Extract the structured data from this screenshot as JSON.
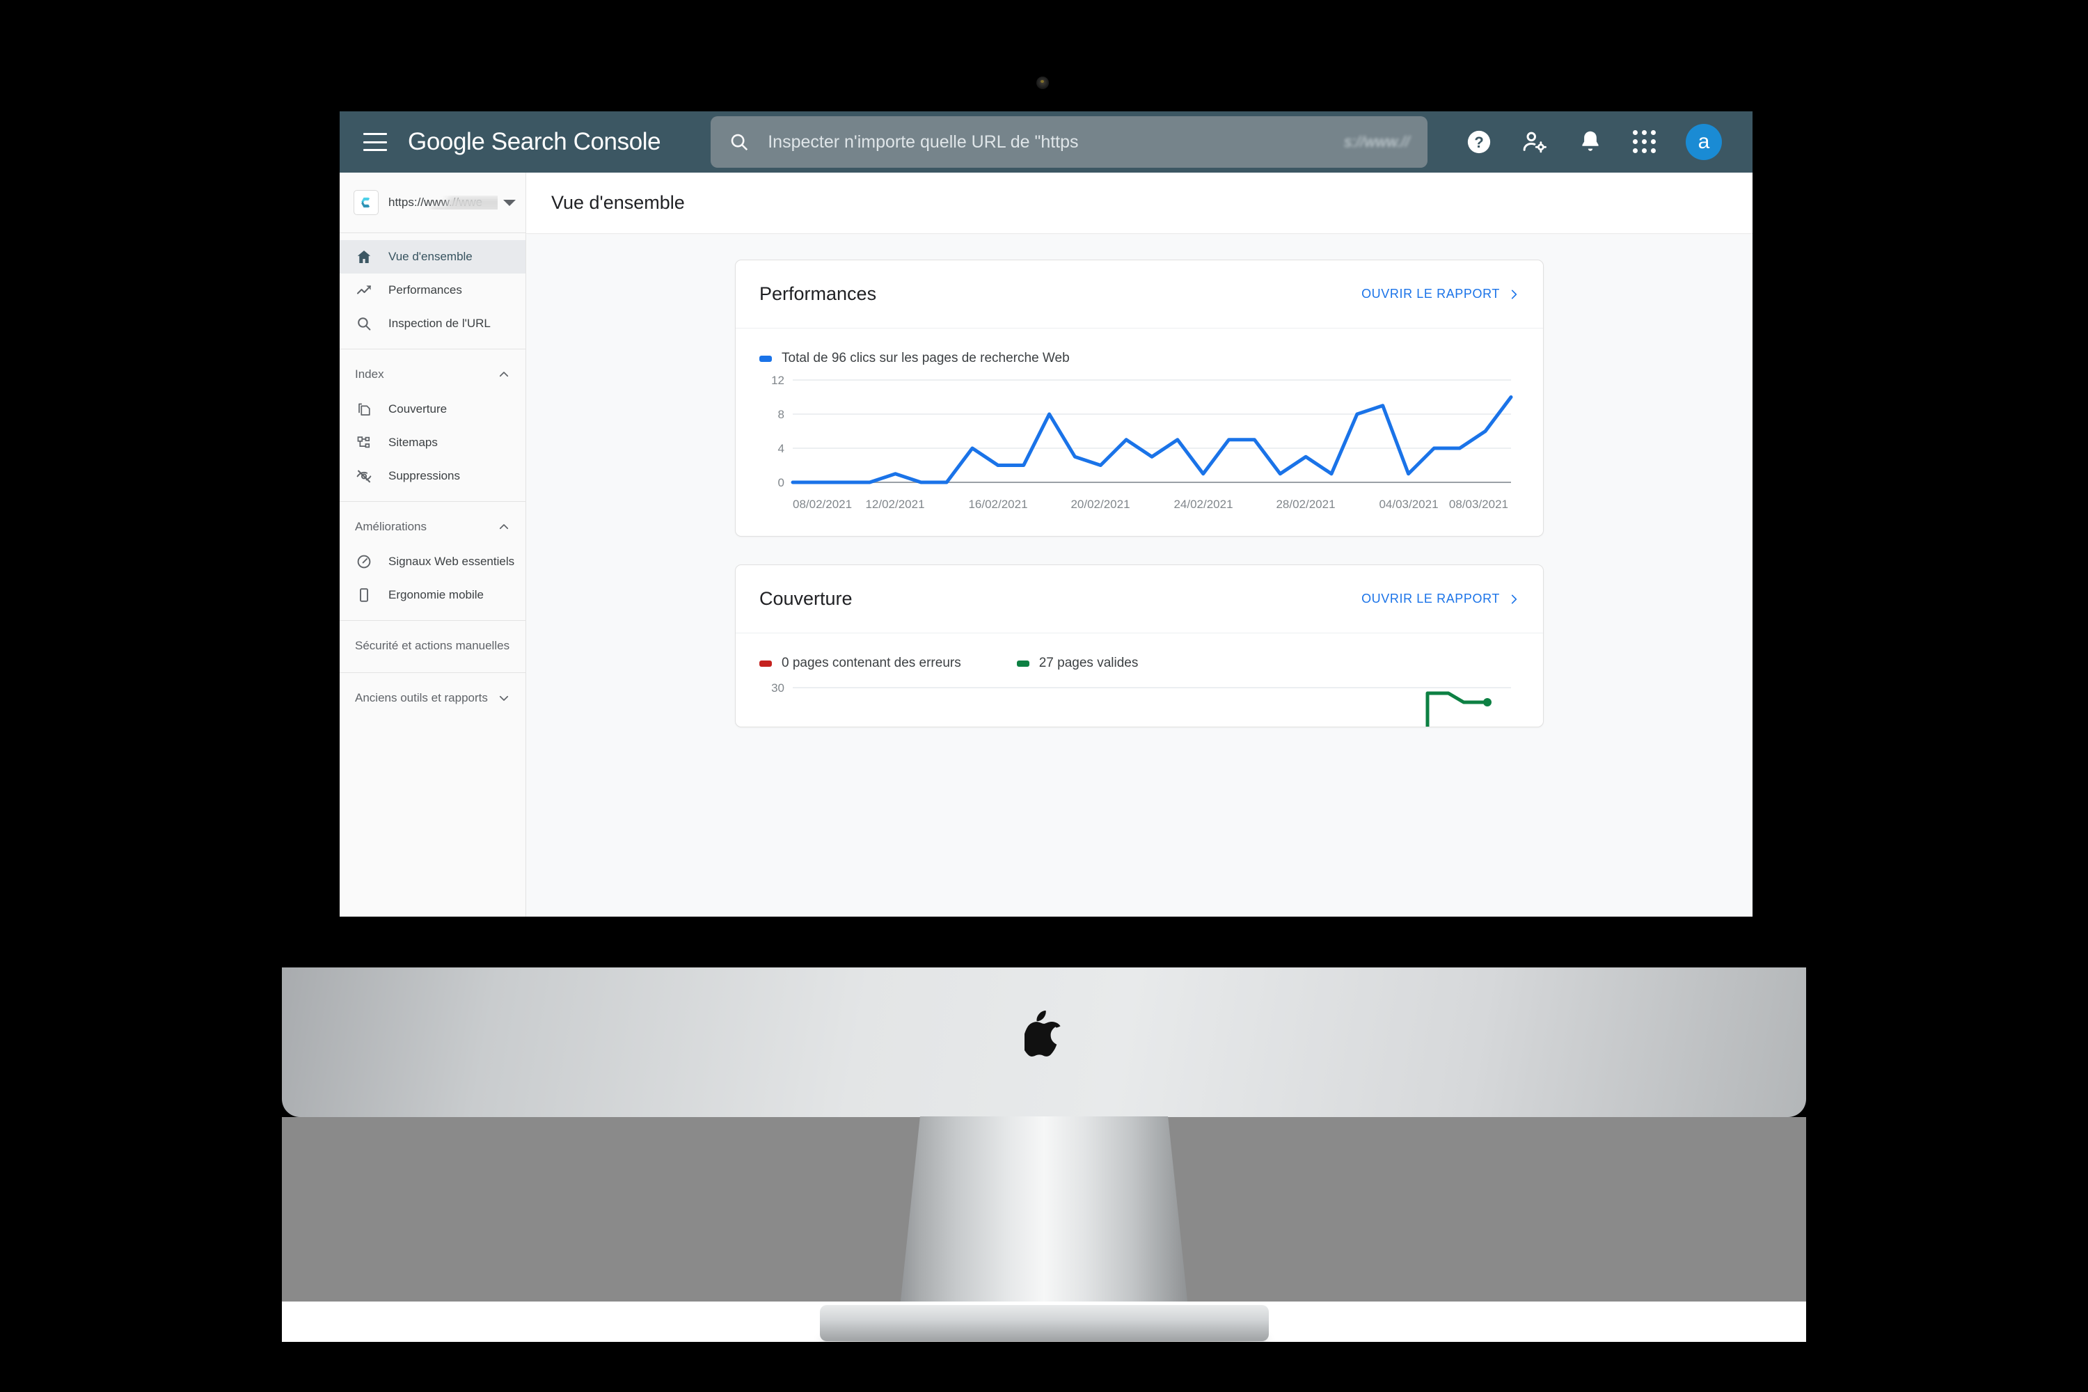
{
  "appbar": {
    "menu_label": "Menu principal",
    "brand_google": "Google",
    "brand_product": "Search Console",
    "search_placeholder": "Inspecter n'importe quelle URL de \"https",
    "search_value": "",
    "search_blur_tail": "s://www.//",
    "help_icon": "help-icon",
    "account_settings_icon": "account-settings-icon",
    "notifications_icon": "bell-icon",
    "apps_icon": "apps-grid-icon",
    "avatar_letter": "a",
    "avatar_color": "#1a8bd4",
    "bar_color": "#3c5763",
    "search_bg": "#76848b"
  },
  "sidebar": {
    "property": {
      "url": "https://www.//wwe",
      "logo_icon": "property-logo-c-icon",
      "dropdown_icon": "chevron-down-icon"
    },
    "primary": [
      {
        "label": "Vue d'ensemble",
        "icon": "home-icon",
        "active": true
      },
      {
        "label": "Performances",
        "icon": "trending-up-icon",
        "active": false
      },
      {
        "label": "Inspection de l'URL",
        "icon": "search-icon",
        "active": false
      }
    ],
    "groups": [
      {
        "header": "Index",
        "chevron": "chevron-up-icon",
        "expanded": true,
        "items": [
          {
            "label": "Couverture",
            "icon": "pages-copy-icon"
          },
          {
            "label": "Sitemaps",
            "icon": "sitemap-icon"
          },
          {
            "label": "Suppressions",
            "icon": "eye-off-icon"
          }
        ]
      },
      {
        "header": "Améliorations",
        "chevron": "chevron-up-icon",
        "expanded": true,
        "items": [
          {
            "label": "Signaux Web essentiels",
            "icon": "speedometer-icon"
          },
          {
            "label": "Ergonomie mobile",
            "icon": "mobile-phone-icon"
          }
        ]
      },
      {
        "header": "Sécurité et actions manuelles",
        "chevron": "chevron-down-icon",
        "expanded": false,
        "items": []
      },
      {
        "header": "Anciens outils et rapports",
        "chevron": "chevron-down-icon",
        "expanded": false,
        "items": []
      }
    ]
  },
  "page": {
    "title": "Vue d'ensemble"
  },
  "cards": [
    {
      "title": "Performances",
      "link_label": "OUVRIR LE RAPPORT",
      "link_icon": "chevron-right-icon",
      "legend": [
        {
          "label": "Total de 96 clics sur les pages de recherche Web",
          "color": "#1a73e8"
        }
      ]
    },
    {
      "title": "Couverture",
      "link_label": "OUVRIR LE RAPPORT",
      "link_icon": "chevron-right-icon",
      "legend": [
        {
          "label": "0 pages contenant des erreurs",
          "color": "#c5221f"
        },
        {
          "label": "27 pages valides",
          "color": "#0d8043"
        }
      ]
    }
  ],
  "chart_data": [
    {
      "type": "line",
      "title": "Performances",
      "series_name": "Total de 96 clics sur les pages de recherche Web",
      "color": "#1a73e8",
      "xlabel": "",
      "ylabel": "",
      "ylim": [
        0,
        12
      ],
      "yticks": [
        0,
        4,
        8,
        12
      ],
      "grid": true,
      "legend_position": "top-left",
      "x": [
        "08/02/2021",
        "09/02/2021",
        "10/02/2021",
        "11/02/2021",
        "12/02/2021",
        "13/02/2021",
        "14/02/2021",
        "15/02/2021",
        "16/02/2021",
        "17/02/2021",
        "18/02/2021",
        "19/02/2021",
        "20/02/2021",
        "21/02/2021",
        "22/02/2021",
        "23/02/2021",
        "24/02/2021",
        "25/02/2021",
        "26/02/2021",
        "27/02/2021",
        "28/02/2021",
        "01/03/2021",
        "02/03/2021",
        "03/03/2021",
        "04/03/2021",
        "05/03/2021",
        "06/03/2021",
        "07/03/2021",
        "08/03/2021",
        "09/03/2021"
      ],
      "xticks": [
        "08/02/2021",
        "12/02/2021",
        "16/02/2021",
        "20/02/2021",
        "24/02/2021",
        "28/02/2021",
        "04/03/2021",
        "08/03/2021"
      ],
      "values": [
        0,
        0,
        0,
        0,
        1,
        0,
        0,
        4,
        2,
        2,
        8,
        3,
        2,
        5,
        3,
        5,
        1,
        5,
        5,
        1,
        3,
        1,
        8,
        9,
        1,
        4,
        4,
        6,
        10
      ]
    },
    {
      "type": "line",
      "title": "Couverture",
      "color_error": "#c5221f",
      "color_valid": "#0d8043",
      "ylim": [
        0,
        32
      ],
      "yticks": [
        30
      ],
      "grid": true,
      "legend_position": "top-left",
      "series": [
        {
          "name": "0 pages contenant des erreurs",
          "values": [
            0,
            0,
            0,
            0,
            0,
            0
          ]
        },
        {
          "name": "27 pages valides",
          "values": [
            0,
            0,
            0,
            0,
            29,
            27
          ]
        }
      ]
    }
  ],
  "device": {
    "brand_logo": "apple-logo-icon",
    "webcam": "webcam-icon"
  }
}
